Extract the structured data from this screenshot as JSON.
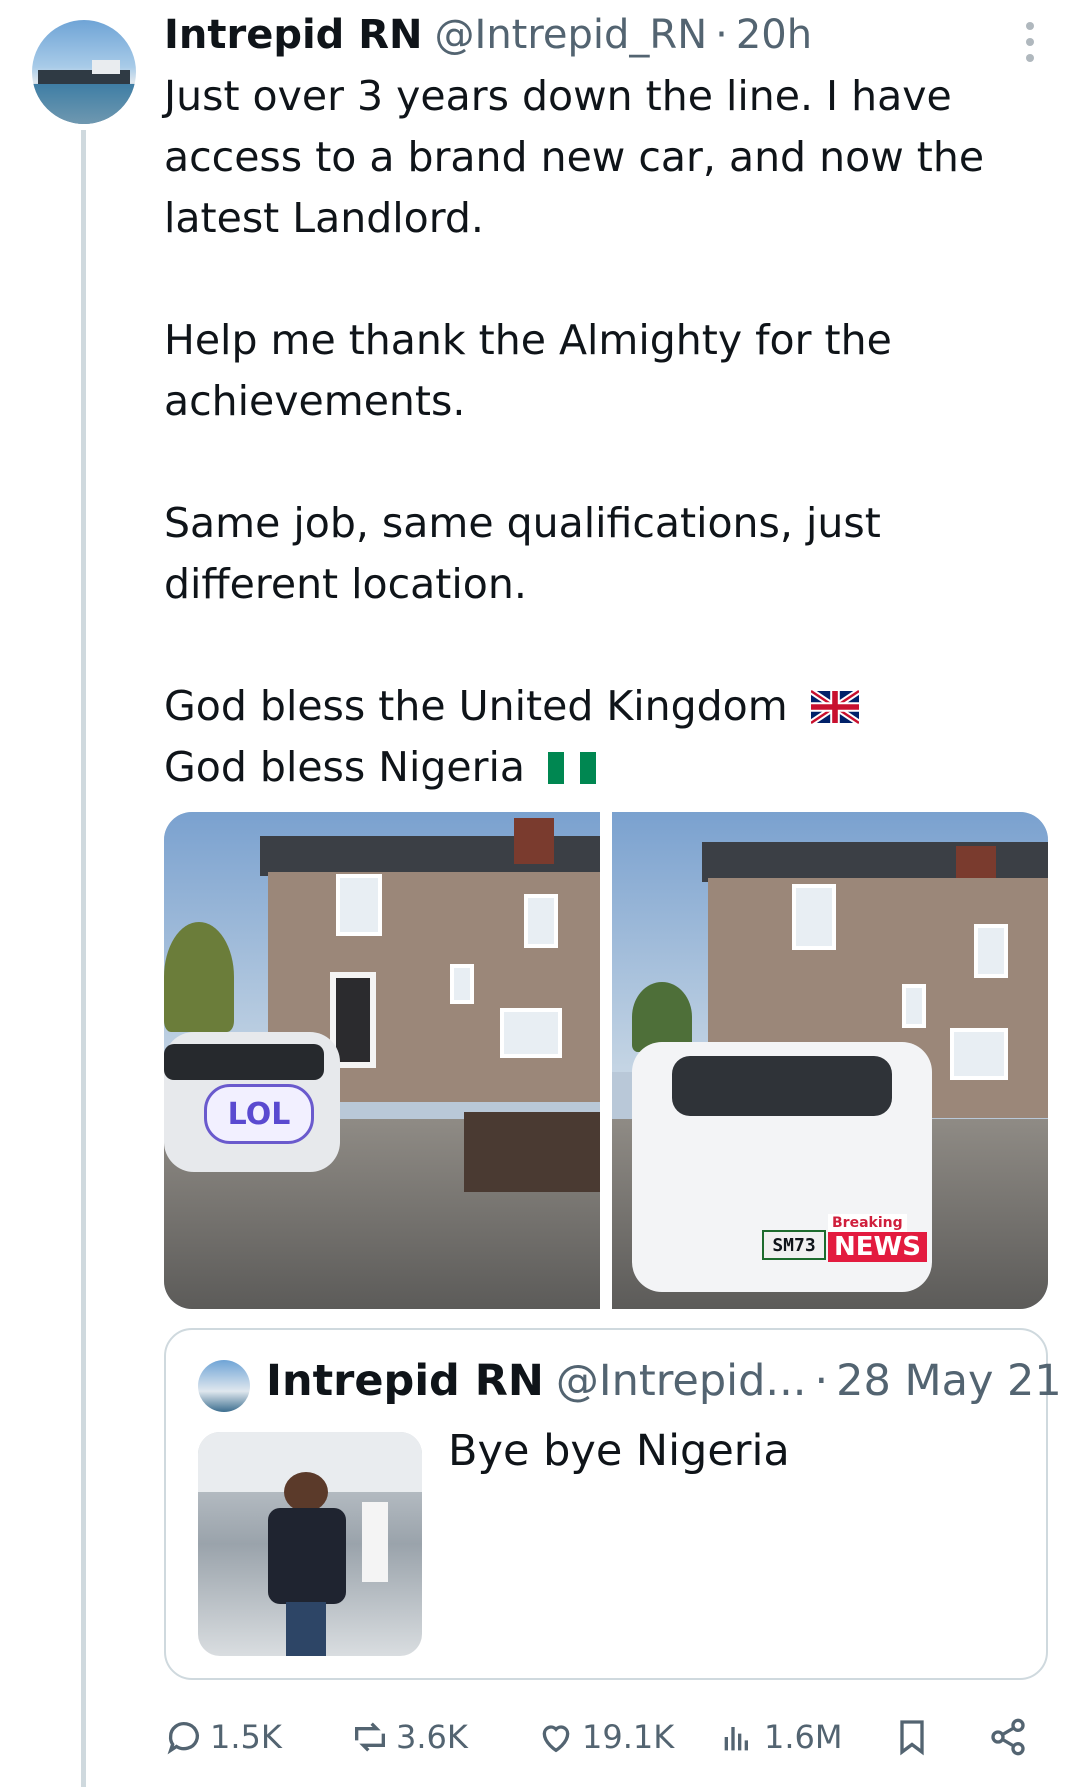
{
  "author": {
    "name": "Intrepid RN",
    "handle": "@Intrepid_RN",
    "separator": "·",
    "time": "20h"
  },
  "tweet": {
    "paragraphs": [
      "Just over 3 years down the line. I have access to a brand new car, and now the latest Landlord.",
      "Help me thank the Almighty for the achievements.",
      "Same job, same qualifications, just different location.",
      "God bless the United Kingdom",
      "God bless Nigeria"
    ]
  },
  "media": {
    "photo1_sticker": "LOL",
    "photo2_plate": "SM73",
    "photo2_badge_top": "Breaking",
    "photo2_badge_bottom": "NEWS"
  },
  "quote": {
    "name": "Intrepid RN",
    "handle": "@Intrepid...",
    "separator": "·",
    "date": "28 May 21",
    "text": "Bye bye Nigeria"
  },
  "actions": {
    "replies": "1.5K",
    "reposts": "3.6K",
    "likes": "19.1K",
    "views": "1.6M"
  },
  "colors": {
    "text": "#0f1419",
    "secondary": "#536471",
    "border": "#cfd9de"
  },
  "icons": [
    "more-icon",
    "reply-icon",
    "repost-icon",
    "like-icon",
    "views-icon",
    "bookmark-icon",
    "share-icon"
  ]
}
